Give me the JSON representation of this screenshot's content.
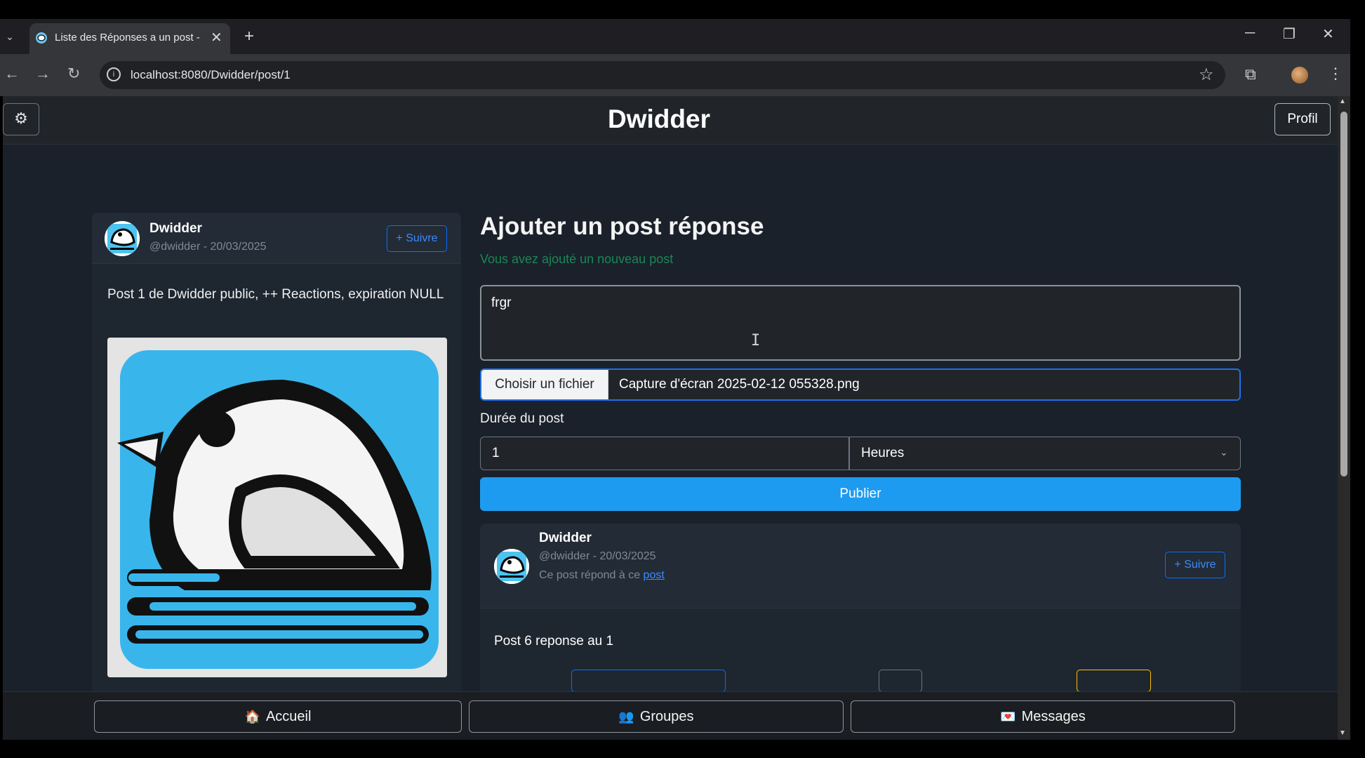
{
  "browser": {
    "tab_title": "Liste des Réponses a un post - ",
    "url": "localhost:8080/Dwidder/post/1"
  },
  "app": {
    "title": "Dwidder",
    "profile_label": "Profil"
  },
  "original_post": {
    "author": "Dwidder",
    "meta": "@dwidder - 20/03/2025",
    "follow_label": "+ Suivre",
    "text": "Post 1 de Dwidder public, ++ Reactions, expiration NULL"
  },
  "reply_form": {
    "heading": "Ajouter un post réponse",
    "success_message": "Vous avez ajouté un nouveau post",
    "textarea_value": "frgr",
    "file_button_label": "Choisir un fichier",
    "file_name": "Capture d'écran 2025-02-12 055328.png",
    "duration_label": "Durée du post",
    "duration_value": "1",
    "duration_unit": "Heures",
    "publish_label": "Publier"
  },
  "reply_post": {
    "author": "Dwidder",
    "meta": "@dwidder - 20/03/2025",
    "reply_to_prefix": "Ce post répond à ce ",
    "reply_to_link": "post",
    "follow_label": "+ Suivre",
    "text": "Post 6 reponse au 1"
  },
  "bottom_nav": {
    "home": {
      "label": "Accueil",
      "icon": "🏠"
    },
    "groups": {
      "label": "Groupes",
      "icon": "👥"
    },
    "messages": {
      "label": "Messages",
      "icon": "💌"
    }
  },
  "colors": {
    "accent": "#1d9bf0",
    "success": "#198754",
    "background": "#1a212b"
  }
}
